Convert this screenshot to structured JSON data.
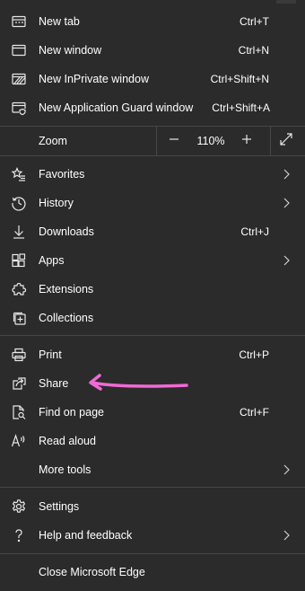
{
  "menu": {
    "new_tab": {
      "label": "New tab",
      "shortcut": "Ctrl+T"
    },
    "new_window": {
      "label": "New window",
      "shortcut": "Ctrl+N"
    },
    "new_inprivate": {
      "label": "New InPrivate window",
      "shortcut": "Ctrl+Shift+N"
    },
    "new_app_guard": {
      "label": "New Application Guard window",
      "shortcut": "Ctrl+Shift+A"
    },
    "zoom": {
      "label": "Zoom",
      "value": "110%",
      "minus": "−",
      "plus": "+"
    },
    "favorites": {
      "label": "Favorites"
    },
    "history": {
      "label": "History"
    },
    "downloads": {
      "label": "Downloads",
      "shortcut": "Ctrl+J"
    },
    "apps": {
      "label": "Apps"
    },
    "extensions": {
      "label": "Extensions"
    },
    "collections": {
      "label": "Collections"
    },
    "print": {
      "label": "Print",
      "shortcut": "Ctrl+P"
    },
    "share": {
      "label": "Share"
    },
    "find_on_page": {
      "label": "Find on page",
      "shortcut": "Ctrl+F"
    },
    "read_aloud": {
      "label": "Read aloud"
    },
    "more_tools": {
      "label": "More tools"
    },
    "settings": {
      "label": "Settings"
    },
    "help_feedback": {
      "label": "Help and feedback"
    },
    "close_edge": {
      "label": "Close Microsoft Edge"
    }
  },
  "colors": {
    "background": "#2b2b2b",
    "divider": "#474747",
    "text": "#ffffff",
    "annotation_arrow": "#f06ad6"
  },
  "icons": {
    "new_tab": "new-tab-icon",
    "new_window": "window-icon",
    "new_inprivate": "inprivate-icon",
    "new_app_guard": "app-guard-icon",
    "zoom_out": "minus-icon",
    "zoom_in": "plus-icon",
    "fullscreen": "fullscreen-icon",
    "favorites": "star-list-icon",
    "history": "history-icon",
    "downloads": "download-icon",
    "apps": "apps-icon",
    "extensions": "puzzle-icon",
    "collections": "collections-icon",
    "print": "printer-icon",
    "share": "share-icon",
    "find_on_page": "find-page-icon",
    "read_aloud": "read-aloud-icon",
    "settings": "gear-icon",
    "help_feedback": "question-icon"
  }
}
